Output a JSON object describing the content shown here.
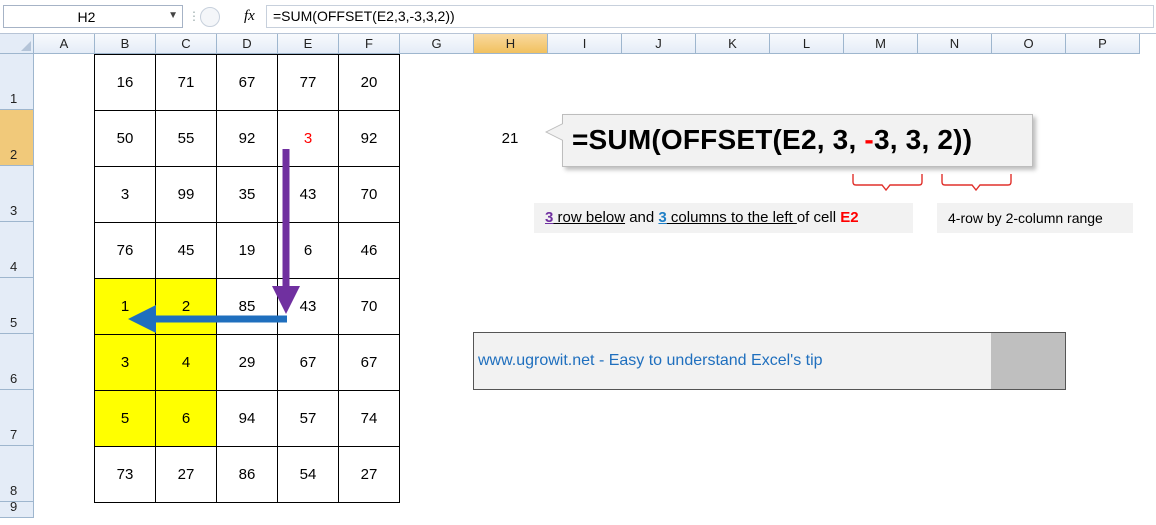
{
  "formula_bar": {
    "name_box": "H2",
    "fx_label": "fx",
    "formula": "=SUM(OFFSET(E2,3,-3,3,2))"
  },
  "columns": [
    "A",
    "B",
    "C",
    "D",
    "E",
    "F",
    "G",
    "H",
    "I",
    "J",
    "K",
    "L",
    "M",
    "N",
    "O",
    "P"
  ],
  "selected_column": "H",
  "rows": [
    "1",
    "2",
    "3",
    "4",
    "5",
    "6",
    "7",
    "8",
    "9"
  ],
  "selected_row": "2",
  "grid": [
    [
      "16",
      "71",
      "67",
      "77",
      "20"
    ],
    [
      "50",
      "55",
      "92",
      "3",
      "92"
    ],
    [
      "3",
      "99",
      "35",
      "43",
      "70"
    ],
    [
      "76",
      "45",
      "19",
      "6",
      "46"
    ],
    [
      "1",
      "2",
      "85",
      "43",
      "70"
    ],
    [
      "3",
      "4",
      "29",
      "67",
      "67"
    ],
    [
      "5",
      "6",
      "94",
      "57",
      "74"
    ],
    [
      "73",
      "27",
      "86",
      "54",
      "27"
    ]
  ],
  "h2_value": "21",
  "callout": {
    "part1": "=SUM(OFFSET(E2, 3, ",
    "neg": "-",
    "part2": "3, 3, 2))"
  },
  "explain": {
    "n1": "3",
    "t1": " row below",
    "t2": " and ",
    "n2": "3",
    "t3": " columns to the left ",
    "t4": "of cell ",
    "cell": "E2"
  },
  "range_note": "4-row by 2-column range",
  "tip": "www.ugrowit.net - Easy to understand Excel's tip",
  "colors": {
    "highlight": "#ffff00",
    "down_arrow": "#7030a0",
    "left_arrow": "#1f6fbe",
    "bracket": "#e0302b"
  }
}
